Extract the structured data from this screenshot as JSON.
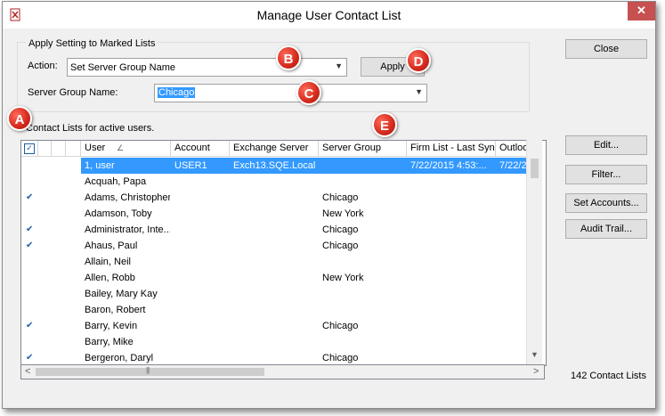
{
  "window": {
    "title": "Manage User Contact List",
    "close_glyph": "✕"
  },
  "settings": {
    "group_label": "Apply Setting to Marked Lists",
    "action_label": "Action:",
    "action_value": "Set Server Group Name",
    "server_group_label": "Server Group Name:",
    "server_group_value": "Chicago",
    "apply_label": "Apply"
  },
  "list_caption": "Contact Lists for active users.",
  "grid": {
    "columns": [
      "User",
      "Account",
      "Exchange Server",
      "Server Group",
      "Firm List - Last Sync",
      "Outlook"
    ],
    "rows": [
      {
        "checked": false,
        "selected": true,
        "user": "1, user",
        "account": "USER1",
        "exchange": "Exch13.SQE.Local",
        "group": "",
        "firm_sync": "7/22/2015 4:53:...",
        "outlook": "7/22/2"
      },
      {
        "checked": false,
        "selected": false,
        "user": "Acquah, Papa",
        "account": "",
        "exchange": "",
        "group": "",
        "firm_sync": "",
        "outlook": ""
      },
      {
        "checked": true,
        "selected": false,
        "user": "Adams, Christopher",
        "account": "",
        "exchange": "",
        "group": "Chicago",
        "firm_sync": "",
        "outlook": ""
      },
      {
        "checked": false,
        "selected": false,
        "user": "Adamson, Toby",
        "account": "",
        "exchange": "",
        "group": "New York",
        "firm_sync": "",
        "outlook": ""
      },
      {
        "checked": true,
        "selected": false,
        "user": "Administrator, Inte...",
        "account": "",
        "exchange": "",
        "group": "Chicago",
        "firm_sync": "",
        "outlook": ""
      },
      {
        "checked": true,
        "selected": false,
        "user": "Ahaus, Paul",
        "account": "",
        "exchange": "",
        "group": "Chicago",
        "firm_sync": "",
        "outlook": ""
      },
      {
        "checked": false,
        "selected": false,
        "user": "Allain, Neil",
        "account": "",
        "exchange": "",
        "group": "",
        "firm_sync": "",
        "outlook": ""
      },
      {
        "checked": false,
        "selected": false,
        "user": "Allen, Robb",
        "account": "",
        "exchange": "",
        "group": "New York",
        "firm_sync": "",
        "outlook": ""
      },
      {
        "checked": false,
        "selected": false,
        "user": "Bailey, Mary Kay",
        "account": "",
        "exchange": "",
        "group": "",
        "firm_sync": "",
        "outlook": ""
      },
      {
        "checked": false,
        "selected": false,
        "user": "Baron, Robert",
        "account": "",
        "exchange": "",
        "group": "",
        "firm_sync": "",
        "outlook": ""
      },
      {
        "checked": true,
        "selected": false,
        "user": "Barry, Kevin",
        "account": "",
        "exchange": "",
        "group": "Chicago",
        "firm_sync": "",
        "outlook": ""
      },
      {
        "checked": false,
        "selected": false,
        "user": "Barry, Mike",
        "account": "",
        "exchange": "",
        "group": "",
        "firm_sync": "",
        "outlook": ""
      },
      {
        "checked": true,
        "selected": false,
        "user": "Bergeron, Daryl",
        "account": "",
        "exchange": "",
        "group": "Chicago",
        "firm_sync": "",
        "outlook": ""
      }
    ]
  },
  "side_buttons": {
    "close": "Close",
    "edit": "Edit...",
    "filter": "Filter...",
    "set_accounts": "Set Accounts...",
    "audit_trail": "Audit Trail..."
  },
  "count_label": "142 Contact Lists",
  "callouts": {
    "a": "A",
    "b": "B",
    "c": "C",
    "d": "D",
    "e": "E"
  },
  "colors": {
    "selection": "#3399ff",
    "callout": "#d3291c",
    "check": "#1c5ea6"
  }
}
